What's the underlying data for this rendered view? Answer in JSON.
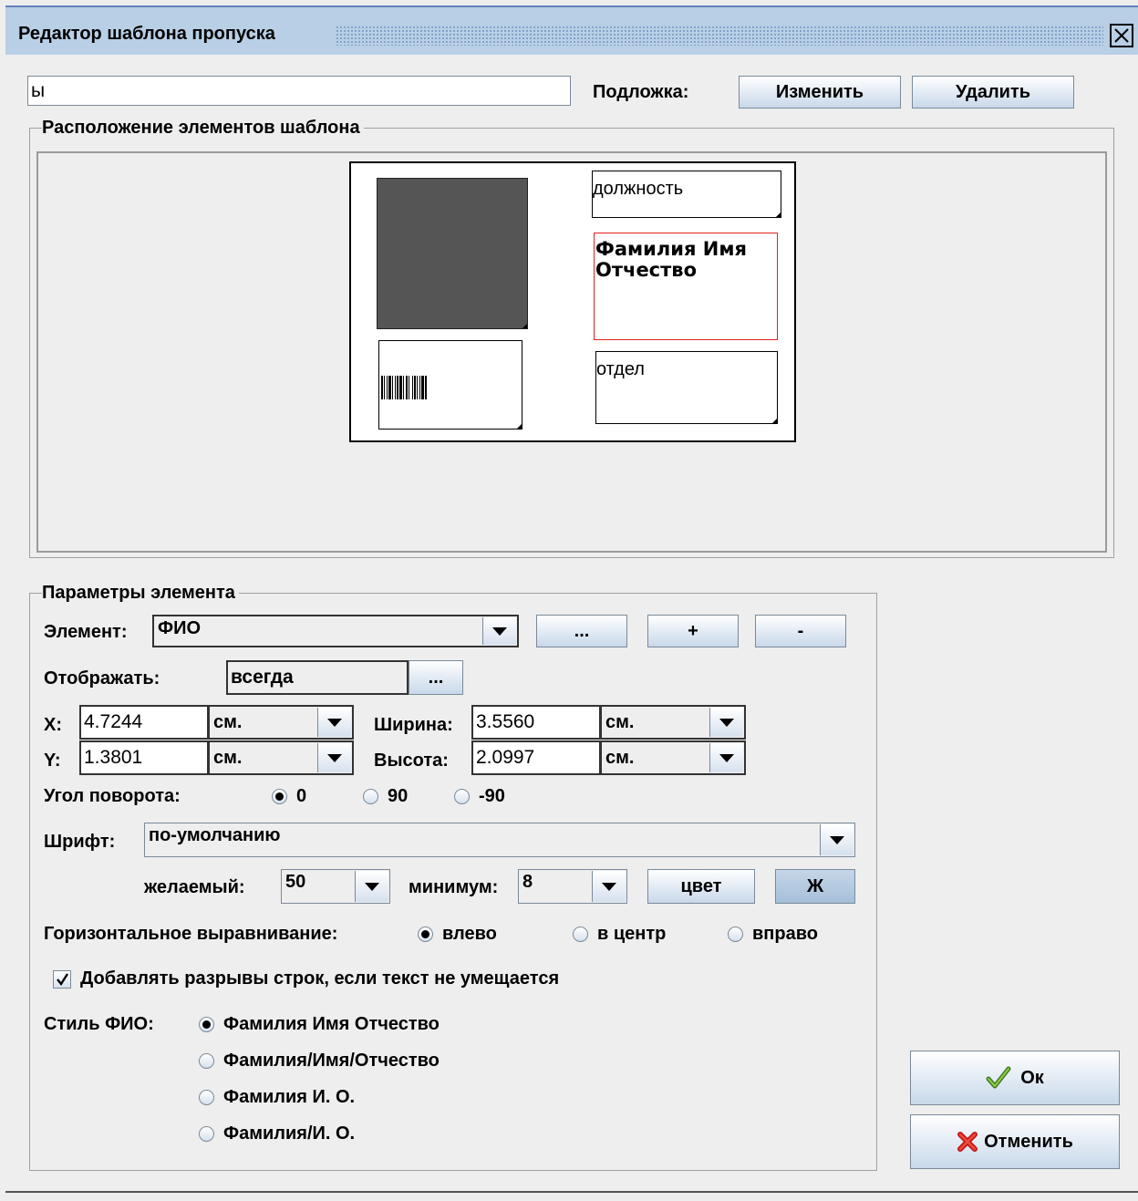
{
  "window": {
    "title": "Редактор шаблона пропуска",
    "close_icon": "close-icon"
  },
  "top": {
    "name_value": "ы",
    "background_label": "Подложка:",
    "change_label": "Изменить",
    "delete_label": "Удалить"
  },
  "layout_group": {
    "legend": "Расположение элементов шаблона",
    "card": {
      "position_text": "должность",
      "name_text": "Фамилия Имя Отчество",
      "dept_text": "отдел"
    }
  },
  "params": {
    "legend": "Параметры элемента",
    "element_label": "Элемент:",
    "element_value": "ФИО",
    "element_more": "...",
    "element_add": "+",
    "element_remove": "-",
    "display_label": "Отображать:",
    "display_value": "всегда",
    "display_more": "...",
    "x_label": "X:",
    "x_value": "4.7244",
    "x_unit": "см.",
    "y_label": "Y:",
    "y_value": "1.3801",
    "y_unit": "см.",
    "width_label": "Ширина:",
    "width_value": "3.5560",
    "width_unit": "см.",
    "height_label": "Высота:",
    "height_value": "2.0997",
    "height_unit": "см.",
    "rotation_label": "Угол поворота:",
    "rotation_options": [
      "0",
      "90",
      "-90"
    ],
    "rotation_selected": "0",
    "font_label": "Шрифт:",
    "font_value": "по-умолчанию",
    "desired_label": "желаемый:",
    "desired_value": "50",
    "minimum_label": "минимум:",
    "minimum_value": "8",
    "color_label": "цвет",
    "bold_label": "Ж",
    "halign_label": "Горизонтальное выравнивание:",
    "halign_options": [
      "влево",
      "в центр",
      "вправо"
    ],
    "halign_selected": "влево",
    "wrap_label": "Добавлять разрывы строк, если текст не умещается",
    "wrap_checked": true,
    "fio_style_label": "Стиль ФИО:",
    "fio_style_options": [
      "Фамилия Имя Отчество",
      "Фамилия/Имя/Отчество",
      "Фамилия И. О.",
      "Фамилия/И. О."
    ],
    "fio_style_selected": "Фамилия Имя Отчество"
  },
  "footer": {
    "ok_label": "Ок",
    "cancel_label": "Отменить"
  },
  "colors": {
    "selection_red": "#e02020",
    "accent": "#b8cfe5",
    "photo_gray": "#555555"
  }
}
